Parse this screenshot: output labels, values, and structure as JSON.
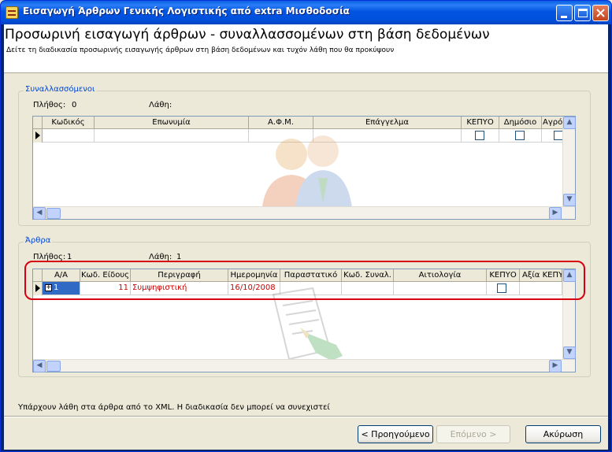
{
  "window": {
    "title": "Εισαγωγή Άρθρων Γενικής Λογιστικής από extra Μισθοδοσία"
  },
  "header": {
    "title": "Προσωρινή εισαγωγή άρθρων - συναλλασσομένων στη βάση δεδομένων",
    "subtitle": "Δείτε τη διαδικασία προσωρινής εισαγωγής άρθρων στη βάση δεδομένων και τυχόν λάθη που θα προκύψουν"
  },
  "parties": {
    "group_label": "Συναλλασσόμενοι",
    "count_label": "Πλήθος:",
    "count_value": "0",
    "errors_label": "Λάθη:",
    "errors_value": "",
    "columns": [
      "Κωδικός",
      "Επωνυμία",
      "Α.Φ.Μ.",
      "Επάγγελμα",
      "ΚΕΠΥΟ",
      "Δημόσιο",
      "Αγρότης μη"
    ]
  },
  "entries": {
    "group_label": "Άρθρα",
    "count_label": "Πλήθος:",
    "count_value": "1",
    "errors_label": "Λάθη:",
    "errors_value": "1",
    "columns": [
      "Α/Α",
      "Κωδ. Είδους",
      "Περιγραφή",
      "Ημερομηνία",
      "Παραστατικό",
      "Κωδ. Συναλ.",
      "Αιτιολογία",
      "ΚΕΠΥΟ",
      "Αξία ΚΕΠΥΟ"
    ],
    "rows": [
      {
        "aa": "1",
        "kod_eidous": "11",
        "perigrafi": "Συμψηφιστική",
        "imerominia": "16/10/2008",
        "parastatiko": "",
        "kod_synal": "",
        "aitiologia": "",
        "kepyo": false,
        "axia_kepyo": ""
      }
    ]
  },
  "status_message": "Υπάρχουν λάθη στα άρθρα από το XML. Η διαδικασία δεν μπορεί να συνεχιστεί",
  "buttons": {
    "back": "< Προηγούμενο",
    "next": "Επόμενο >",
    "cancel": "Ακύρωση"
  },
  "colors": {
    "error_text": "#cc0000",
    "highlight_oval": "#d80010",
    "group_label": "#0046d5"
  }
}
